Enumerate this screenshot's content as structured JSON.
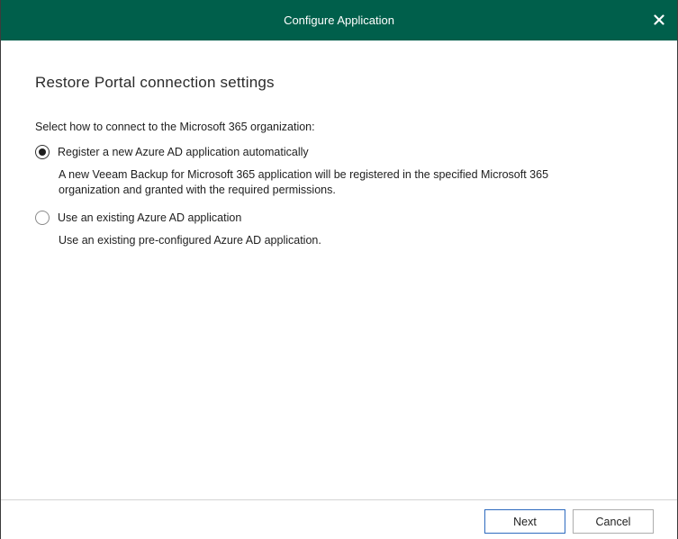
{
  "window": {
    "title": "Configure Application",
    "close_icon": "close-icon",
    "titlebar_color": "#005f4b"
  },
  "page": {
    "heading": "Restore Portal connection settings",
    "prompt": "Select how to connect to the Microsoft 365 organization:"
  },
  "options": [
    {
      "label": "Register a new Azure AD application automatically",
      "selected": true,
      "description_line1": "A new Veeam Backup for Microsoft 365 application will be registered in the specified Microsoft 365",
      "description_line2": "organization and granted with the required permissions."
    },
    {
      "label": "Use an existing Azure AD application",
      "selected": false,
      "description_line1": "Use an existing pre-configured Azure AD application."
    }
  ],
  "footer": {
    "next_label": "Next",
    "cancel_label": "Cancel"
  }
}
